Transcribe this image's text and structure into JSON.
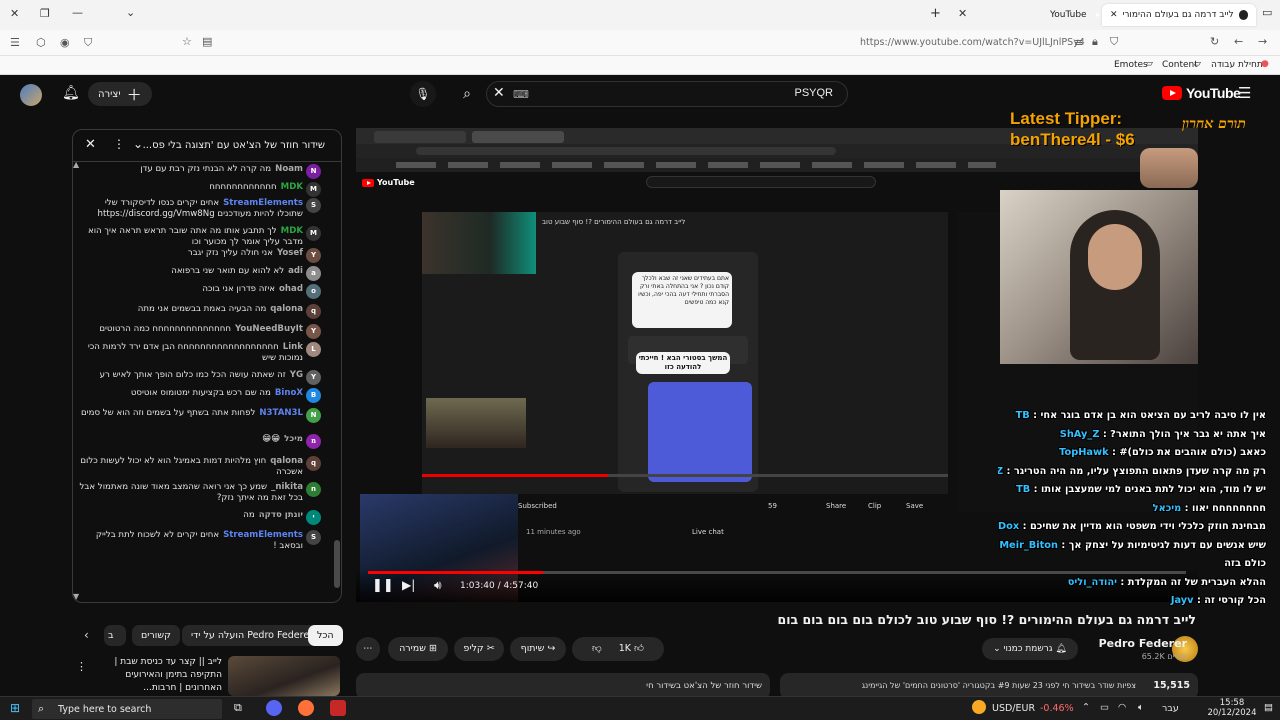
{
  "browser": {
    "tabs": [
      {
        "label": "לייב דרמה גם בעולם ההימורים ?! סוף",
        "active": true
      },
      {
        "label": "YouTube",
        "active": false
      }
    ],
    "url": "https://www.youtube.com/watch?v=UJlLJnlPSy4",
    "bookmarks": [
      "Emotes",
      "Content",
      "תחילת עבודה"
    ]
  },
  "masthead": {
    "search_value": "PSYQR",
    "create_label": "יצירה",
    "logo_text": "YouTube"
  },
  "chat": {
    "title": "שידור חוזר של הצ'אט עם 'תצוגה בלי פס...",
    "messages": [
      {
        "author": "Noam",
        "text": "מה קרה לא הבנתי נזק רבת עם עדן",
        "avatar": "N",
        "color": "#7b1fa2",
        "role": ""
      },
      {
        "author": "MDK",
        "text": "חחחחחחחחחחחח",
        "avatar": "M",
        "color": "#333333",
        "role": "member"
      },
      {
        "author": "StreamElements",
        "text": "אחים יקרים כנסו לדיסקורד שלי שתוכלו להיות מעודכנים https://discord.gg/Vmw8Ng",
        "avatar": "S",
        "color": "#444444",
        "role": "mod"
      },
      {
        "author": "MDK",
        "text": "לך תתבע אותו מה אתה שובר תראש תראה איך הוא מדבר עליך אומר לך מכוער וכו",
        "avatar": "M",
        "color": "#333333",
        "role": "member"
      },
      {
        "author": "Yosef",
        "text": "אני חולה עליך נזק יגבר",
        "avatar": "Y",
        "color": "#6d4c41",
        "role": ""
      },
      {
        "author": "adi",
        "text": "לא להוא עם תואר שני ברפואה",
        "avatar": "a",
        "color": "#8d8d8d",
        "role": ""
      },
      {
        "author": "ohad",
        "text": "איזה פדרון אני בוכה",
        "avatar": "o",
        "color": "#546e7a",
        "role": ""
      },
      {
        "author": "qalona",
        "text": "מה הבעיה באמת בבשמים אני מתה",
        "avatar": "q",
        "color": "#5d4037",
        "role": ""
      },
      {
        "author": "YouNeedBuyIt",
        "text": "חחחחחחחחחחחחחח כמה הרטוטים",
        "avatar": "Y",
        "color": "#795548",
        "role": ""
      },
      {
        "author": "Link",
        "text": "חחחחחחחחחחחחחחחחחח הבן אדם ירד לרמות הכי נמוכות שיש",
        "avatar": "L",
        "color": "#a1887f",
        "role": ""
      },
      {
        "author": "YG",
        "text": "זה שאתה עושה הכל כמו כלום הופך אותך לאיש רע",
        "avatar": "Y",
        "color": "#616161",
        "role": ""
      },
      {
        "author": "BinoX",
        "text": "מה שם רכש בקציעות ימטומוס אוטיסט",
        "avatar": "B",
        "color": "#1e88e5",
        "role": "mod"
      },
      {
        "author": "N3TAN3L",
        "text": "לפחות אתה בשתף על בשמים וזה הוא של סמים",
        "avatar": "N",
        "color": "#43a047",
        "role": "mod"
      },
      {
        "author": "מיכל",
        "text": "😁😁",
        "avatar": "מ",
        "color": "#8e24aa",
        "role": ""
      },
      {
        "author": "qalona",
        "text": "חוץ מלהיות דמות באמיגל הוא לא יכול לעשות כלום אשכרה",
        "avatar": "q",
        "color": "#5d4037",
        "role": ""
      },
      {
        "author": "nikita_",
        "text": "שמע כך אני רואה שהמצב מאוד שונה מאתמול אבל בכל זאת מה איתך נזק?",
        "avatar": "n",
        "color": "#2e7d32",
        "role": ""
      },
      {
        "author": "יונתן סדקה",
        "text": "מה",
        "avatar": "י",
        "color": "#00897b",
        "role": ""
      },
      {
        "author": "StreamElements",
        "text": "אחים יקרים לא לשכוח לתת בלייק ובסאב !",
        "avatar": "S",
        "color": "#444444",
        "role": "mod"
      }
    ]
  },
  "chips": [
    "הכל",
    "הועלה על ידי Pedro Federer",
    "קשורים",
    "ב"
  ],
  "sidebar_video": {
    "title": "לייב || קצר עד כניסת שבת | התקיפה בתימן והאירועים האחרונים | חרבות..."
  },
  "player": {
    "time_current": "1:03:40",
    "time_total": "4:57:40",
    "progress": 0.214
  },
  "overlay": {
    "tipper_title": "Latest Tipper:",
    "tipper_name": "benThere4l - $6",
    "tipper_hebrew": "תורם אחרון",
    "inner_video_title": "לייב דרמה גם בעולם ההימורים ?! סוף שבוע טוב",
    "inner_bubble_top": "אתם בעתידים שאני זה שבא ולכלך קודם נכון ? אני בהתחלה באתי ורק הסברתי ותחילי דעה בהכי יפה, וכשיו קנא כמה טיפשים",
    "inner_bubble_next": "המשך בסטורי הבא ! חייכתי להודעה כזו",
    "inner_time_ago": "11 minutes ago",
    "inner_subscribed": "Subscribed",
    "inner_live_chat": "Live chat",
    "inner_share": "Share",
    "inner_clip": "Clip",
    "inner_save": "Save",
    "inner_likes": "59",
    "chat_lines": [
      {
        "name": "TB",
        "text": "אין לו סיבה לריב עם הציאט הוא בן אדם בוגר אחי"
      },
      {
        "name": "ShAy_Z",
        "text": "איך אתה יא גבר איך הולך התואר?"
      },
      {
        "name": "TopHawk",
        "text": "כאאב (כולם אוהבים את כולם)#"
      },
      {
        "name": "MPZ",
        "text": "רק מה קרה שעדן פתאום התפוצץ עליו, מה היה הטריגר"
      },
      {
        "name": "TB",
        "text": "יש לו מוד, הוא יכול לתת באנים למי שמעצבן אותו"
      },
      {
        "name": "מיכאל",
        "text": "חחחחחחחח יאוו"
      },
      {
        "name": "Dil_Dox",
        "text": "מבחינת חוזק כלכלי וידי משפטי הוא מדיין את שחיכם"
      },
      {
        "name": "Meir_Biton",
        "text": "שיש אנשים עם דעות לגיטימיות על יצחק אך"
      },
      {
        "name": "",
        "text": "כולם בזה"
      },
      {
        "name": "יהודה_וליס",
        "text": "ההלא העברית של זה המקלדת"
      },
      {
        "name": "Jayv",
        "text": "הכל קורסי זה"
      }
    ]
  },
  "below": {
    "video_title": "לייב דרמה גם בעולם ההימורים ?! סוף שבוע טוב לכולם בום בום בום בום",
    "channel_name": "Pedro Federer",
    "subscribers": "65.2K מנויים",
    "notify_label": "גרשמת כמנוי",
    "likes": "1K",
    "share_label": "שיתוף",
    "clip_label": "קליפ",
    "save_label": "שמירה",
    "desc_views": "15,515",
    "desc_text": "צפיות  שודר בשידור חי לפני 23 שעות  #9 בקטגוריה 'סרטונים החמים' של הגיימינג",
    "replay_chat": "שידור חוזר של הצ'אט בשידור חי"
  },
  "taskbar": {
    "search_placeholder": "Type here to search",
    "ticker_name": "USD/EUR",
    "ticker_change": "-0.46%",
    "language": "עבר",
    "time": "15:58",
    "date": "20/12/2024"
  },
  "colors": {
    "yt_red": "#ff0000",
    "tipper_orange": "#f4a300",
    "member_green": "#2ba640",
    "mod_blue": "#5e84f1",
    "bg": "#0f0f0f"
  }
}
